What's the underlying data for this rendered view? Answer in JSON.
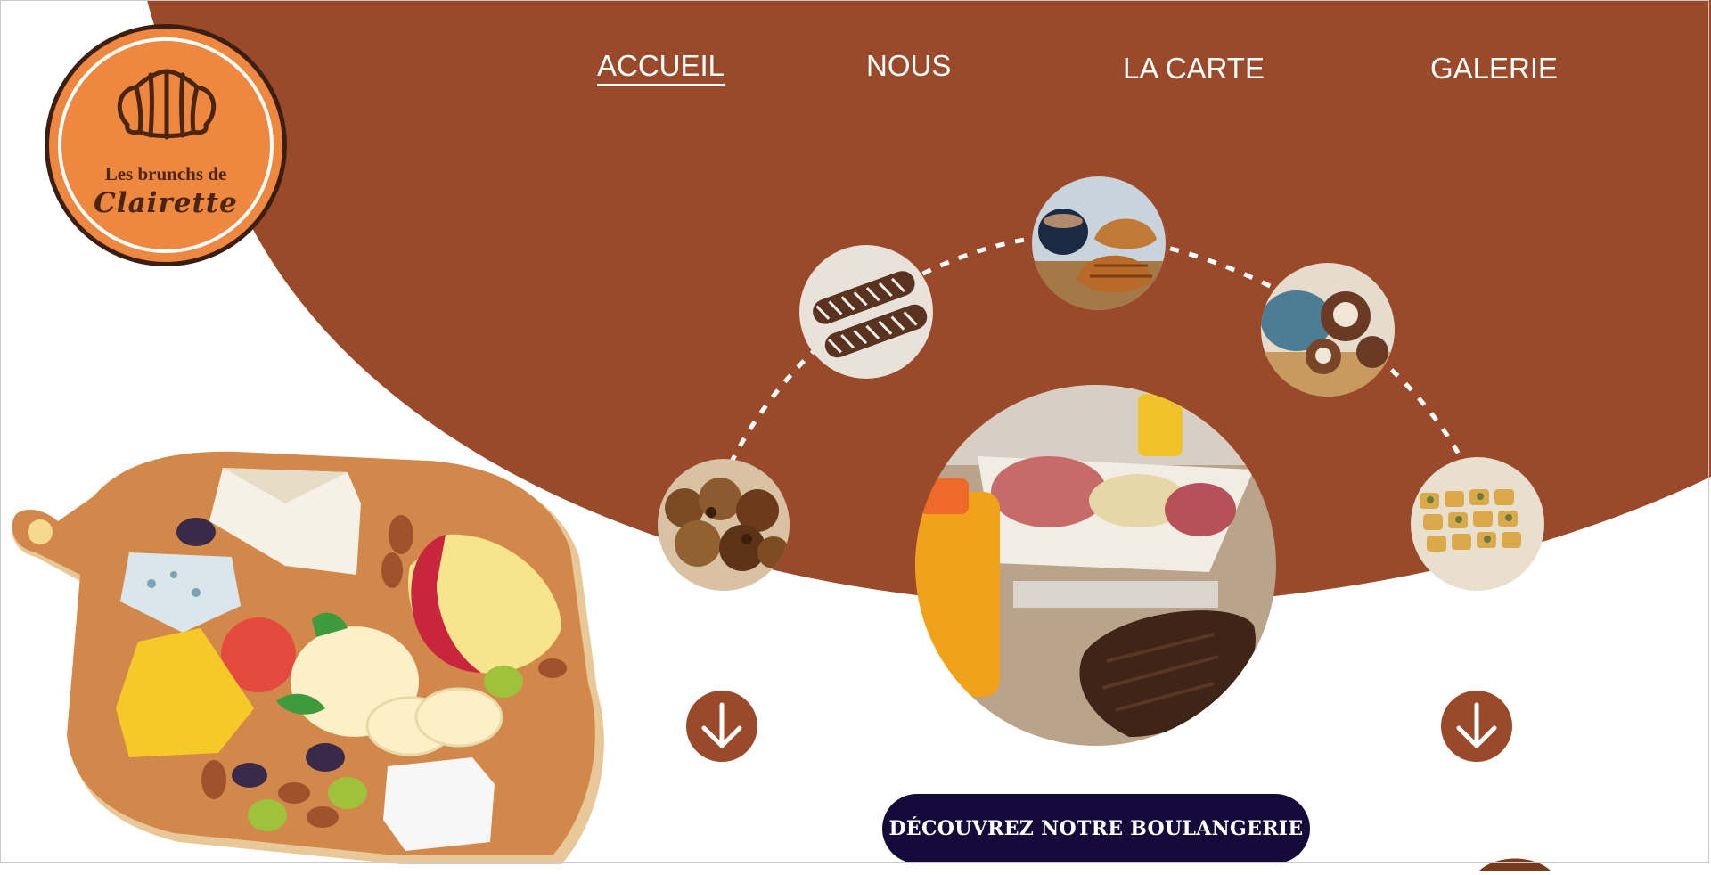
{
  "brand": {
    "line1": "Les brunchs de",
    "line2": "Clairette",
    "colors": {
      "primary": "#9a4a2a",
      "logo": "#ee8740",
      "cta": "#150b3a"
    }
  },
  "nav": {
    "items": [
      {
        "label": "ACCUEIL",
        "active": true
      },
      {
        "label": "NOUS",
        "active": false
      },
      {
        "label": "LA CARTE",
        "active": false
      },
      {
        "label": "GALERIE",
        "active": false
      }
    ]
  },
  "gallery": {
    "photos": [
      "cookies-photo",
      "eclairs-photo",
      "croissants-coffee-photo",
      "cinnamon-rolls-photo",
      "quiche-bites-photo",
      "brunch-plate-photo"
    ]
  },
  "actions": {
    "cta_label": "DÉCOUVREZ NOTRE BOULANGERIE",
    "scroll_icon": "arrow-down-icon"
  }
}
